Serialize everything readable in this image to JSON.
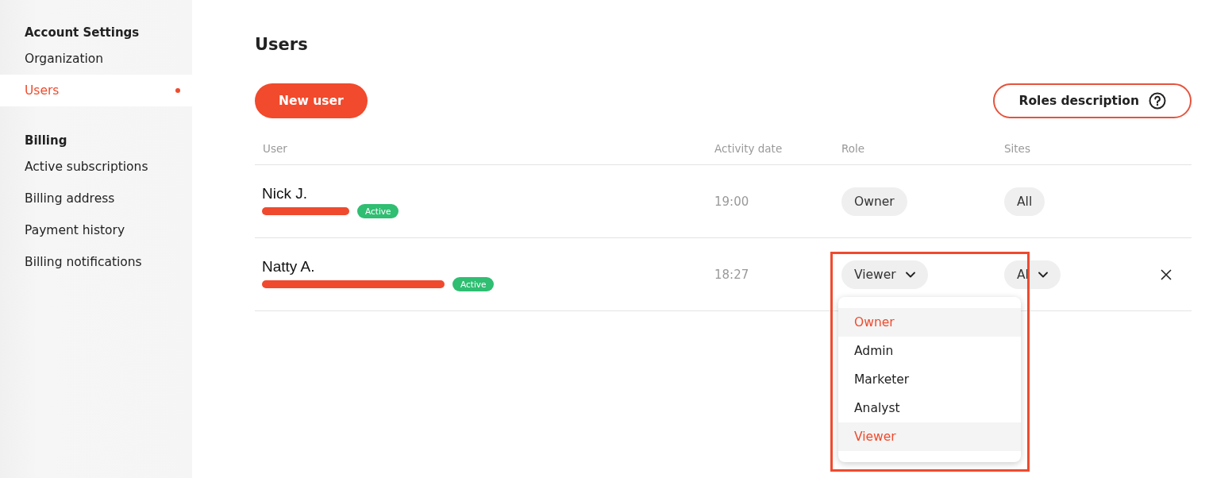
{
  "sidebar": {
    "sections": [
      {
        "title": "Account Settings",
        "items": [
          {
            "label": "Organization",
            "selected": false
          },
          {
            "label": "Users",
            "selected": true
          }
        ]
      },
      {
        "title": "Billing",
        "items": [
          {
            "label": "Active subscriptions",
            "selected": false
          },
          {
            "label": "Billing address",
            "selected": false
          },
          {
            "label": "Payment history",
            "selected": false
          },
          {
            "label": "Billing notifications",
            "selected": false
          }
        ]
      }
    ]
  },
  "page": {
    "title": "Users",
    "new_user_button": "New user",
    "roles_button": "Roles description"
  },
  "table": {
    "columns": [
      "User",
      "Activity date",
      "Role",
      "Sites"
    ],
    "rows": [
      {
        "name": "Nick J.",
        "status": "Active",
        "activity_date": "19:00",
        "role": "Owner",
        "sites": "All",
        "editable": false
      },
      {
        "name": "Natty A.",
        "status": "Active",
        "activity_date": "18:27",
        "role": "Viewer",
        "sites": "Al",
        "editable": true
      }
    ]
  },
  "role_menu": {
    "items": [
      {
        "label": "Owner",
        "selected": true
      },
      {
        "label": "Admin",
        "selected": false
      },
      {
        "label": "Marketer",
        "selected": false
      },
      {
        "label": "Analyst",
        "selected": false
      },
      {
        "label": "Viewer",
        "selected": true
      }
    ]
  }
}
